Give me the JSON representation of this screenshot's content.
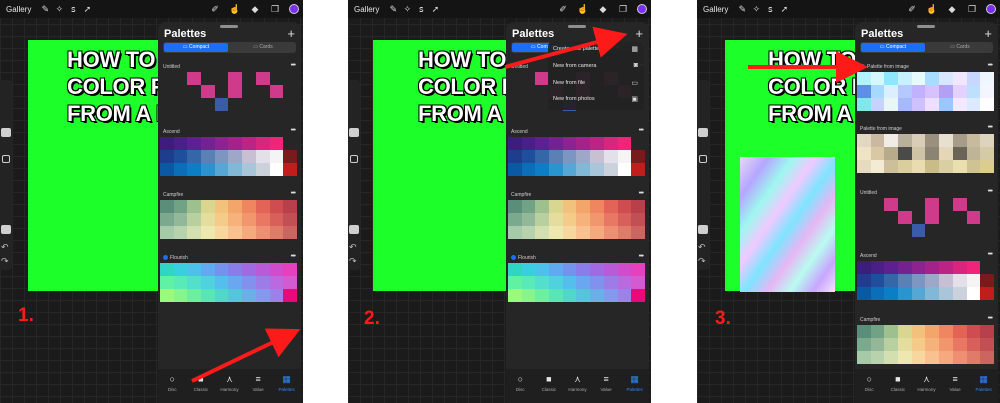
{
  "panels": [
    {
      "gallery": "Gallery",
      "canvas_text": [
        "HOW TO",
        "COLOR P",
        "FROM A I"
      ],
      "step": "1.",
      "sheet": {
        "title": "Palettes",
        "seg": [
          "Compact",
          "Cards"
        ],
        "palettes": [
          {
            "name": "Untitled",
            "checked": false,
            "rows": 3,
            "colors": [
              "",
              "",
              "#cf3a8a",
              "",
              "",
              "#cf3a8a",
              "",
              "#cf3a8a",
              "",
              "",
              "",
              "",
              "",
              "#cf3a8a",
              "",
              "#cf3a8a",
              "",
              "",
              "#cf3a8a",
              "",
              "",
              "",
              "",
              "",
              "#3a5ba8",
              "",
              "",
              "",
              "",
              ""
            ]
          },
          {
            "name": "Ascend",
            "checked": false,
            "rows": 3,
            "colors": [
              "#3a1e7a",
              "#4a1f86",
              "#5d2090",
              "#73228f",
              "#8c2390",
              "#a3238b",
              "#bc2484",
              "#d9257d",
              "#f1247a",
              "",
              "#1e3d8d",
              "#1f4f9c",
              "#3466a8",
              "#5a80b6",
              "#7d95c1",
              "#9fa7c9",
              "#c9bfd3",
              "#e3e0e9",
              "#f4f4f4",
              "#7a1b1b",
              "#0a5aa3",
              "#0a6eb8",
              "#0b7fc6",
              "#2a94cf",
              "#56a7d3",
              "#80b8d6",
              "#a8c5d9",
              "#cbd2db",
              "#ffffff",
              "#c11d1d"
            ]
          },
          {
            "name": "Campfire",
            "checked": false,
            "rows": 3,
            "colors": [
              "#5a8e7a",
              "#72a285",
              "#9ec08f",
              "#d8d68f",
              "#f2c17c",
              "#f4a56a",
              "#ef8660",
              "#e36457",
              "#cf4d50",
              "#b8404a",
              "#7aa98e",
              "#93b899",
              "#b8cf9f",
              "#e4dd9e",
              "#f5cb8a",
              "#f6b27a",
              "#f2976d",
              "#e87863",
              "#d8605b",
              "#c24f53",
              "#a6c9a7",
              "#b9d2ae",
              "#d4dfb1",
              "#eee7b0",
              "#f8d79f",
              "#f9c18f",
              "#f6a97f",
              "#ee8f73",
              "#e07a69",
              "#cc6560"
            ]
          },
          {
            "name": "Flourish",
            "checked": true,
            "rows": 3,
            "colors": [
              "#2fd6c4",
              "#39cfe0",
              "#4bc1ec",
              "#5faaf0",
              "#7592ee",
              "#8b7de9",
              "#a16ae2",
              "#b95ad8",
              "#d04ccc",
              "#e540bd",
              "#5ff2a4",
              "#58eab8",
              "#52e0cc",
              "#4fd2de",
              "#55beec",
              "#6aa7f0",
              "#8391ee",
              "#9d7ce7",
              "#b86ade",
              "#d35ad1",
              "#9cfa7a",
              "#84f68c",
              "#6cf0a0",
              "#58e6b5",
              "#4fd8c8",
              "#55c6da",
              "#69b0e8",
              "#8398ee",
              "#9e80ea",
              "#e80a7a"
            ]
          }
        ],
        "nav": [
          {
            "label": "Disc",
            "icon": "○",
            "active": false
          },
          {
            "label": "Classic",
            "icon": "■",
            "active": false
          },
          {
            "label": "Harmony",
            "icon": "⋏",
            "active": false
          },
          {
            "label": "Value",
            "icon": "≡",
            "active": false
          },
          {
            "label": "Palettes",
            "icon": "▦",
            "active": true
          }
        ]
      }
    },
    {
      "gallery": "Gallery",
      "canvas_text": [
        "HOW TO",
        "COLOR P",
        "FROM A I"
      ],
      "step": "2.",
      "menu": [
        {
          "label": "Create new palette",
          "icon": "▦"
        },
        {
          "label": "New from camera",
          "icon": "◙"
        },
        {
          "label": "New from file",
          "icon": "▭"
        },
        {
          "label": "New from photos",
          "icon": "▣"
        }
      ]
    },
    {
      "gallery": "Gallery",
      "canvas_text": [
        "HOW TO",
        "COLOR P",
        "FROM A I"
      ],
      "step": "3.",
      "sheet": {
        "title": "Palettes",
        "seg": [
          "Compact",
          "Cards"
        ],
        "palettes": [
          {
            "name": "Palette from image",
            "checked": true,
            "rows": 3,
            "colors": [
              "#b2f3ff",
              "#d7f7ff",
              "#8fe6ff",
              "#c9f0ff",
              "#e6fbff",
              "#a9ddff",
              "#d9e6ff",
              "#f1e6ff",
              "#c7d7ff",
              "#eef6ff",
              "#5e8fe4",
              "#a6d9ff",
              "#dcefff",
              "#b5c8ff",
              "#c1b2ff",
              "#d7c2ff",
              "#b1a0f4",
              "#e3d1ff",
              "#bde0ff",
              "#f5f5ff",
              "#7fe9ea",
              "#c8d2ff",
              "#e8f7f4",
              "#a6b9ff",
              "#cfc0ff",
              "#efdfff",
              "#9bc7ff",
              "#f3e9ff",
              "#dce9ff",
              "#ffffff"
            ]
          },
          {
            "name": "Palette from image",
            "checked": false,
            "rows": 3,
            "colors": [
              "#e2d8c2",
              "#cbb8a0",
              "#f1ede6",
              "#b9b09c",
              "#d9cdb8",
              "#9b8f7e",
              "#e8e0cf",
              "#a79c8a",
              "#c8bb9d",
              "#ded3bd",
              "#f0e2c4",
              "#d8c9a4",
              "#b8ab8c",
              "#4a4b48",
              "#cfc3a6",
              "#8c8473",
              "#e4d6b7",
              "#6b6557",
              "#c0b498",
              "#d6caa6",
              "#e6dbbf",
              "#f3ebd3",
              "#cdbf9c",
              "#dacd9e",
              "#e9dcb0",
              "#c9bc89",
              "#d8cfa2",
              "#eadfae",
              "#cfc294",
              "#dbcc8f"
            ]
          },
          {
            "name": "Untitled",
            "checked": false,
            "rows": 3,
            "colors": [
              "",
              "",
              "#cf3a8a",
              "",
              "",
              "#cf3a8a",
              "",
              "#cf3a8a",
              "",
              "",
              "",
              "",
              "",
              "#cf3a8a",
              "",
              "#cf3a8a",
              "",
              "",
              "#cf3a8a",
              "",
              "",
              "",
              "",
              "",
              "#3a5ba8",
              "",
              "",
              "",
              "",
              ""
            ]
          },
          {
            "name": "Ascend",
            "checked": false,
            "rows": 3,
            "colors": [
              "#3a1e7a",
              "#4a1f86",
              "#5d2090",
              "#73228f",
              "#8c2390",
              "#a3238b",
              "#bc2484",
              "#d9257d",
              "#f1247a",
              "",
              "#1e3d8d",
              "#1f4f9c",
              "#3466a8",
              "#5a80b6",
              "#7d95c1",
              "#9fa7c9",
              "#c9bfd3",
              "#e3e0e9",
              "#f4f4f4",
              "#7a1b1b",
              "#0a5aa3",
              "#0a6eb8",
              "#0b7fc6",
              "#2a94cf",
              "#56a7d3",
              "#80b8d6",
              "#a8c5d9",
              "#cbd2db",
              "#ffffff",
              "#c11d1d"
            ]
          },
          {
            "name": "Campfire",
            "checked": false,
            "rows": 3,
            "colors": [
              "#5a8e7a",
              "#72a285",
              "#9ec08f",
              "#d8d68f",
              "#f2c17c",
              "#f4a56a",
              "#ef8660",
              "#e36457",
              "#cf4d50",
              "#b8404a",
              "#7aa98e",
              "#93b899",
              "#b8cf9f",
              "#e4dd9e",
              "#f5cb8a",
              "#f6b27a",
              "#f2976d",
              "#e87863",
              "#d8605b",
              "#c24f53",
              "#a6c9a7",
              "#b9d2ae",
              "#d4dfb1",
              "#eee7b0",
              "#f8d79f",
              "#f9c18f",
              "#f6a97f",
              "#ee8f73",
              "#e07a69",
              "#cc6560"
            ]
          }
        ],
        "nav": [
          {
            "label": "Disc",
            "icon": "○",
            "active": false
          },
          {
            "label": "Classic",
            "icon": "■",
            "active": false
          },
          {
            "label": "Harmony",
            "icon": "⋏",
            "active": false
          },
          {
            "label": "Value",
            "icon": "≡",
            "active": false
          },
          {
            "label": "Palettes",
            "icon": "▦",
            "active": true
          }
        ]
      }
    }
  ],
  "colors": {
    "accent": "#1c6ef5",
    "canvas": "#1cff28",
    "arrow": "#ff1a1a"
  }
}
